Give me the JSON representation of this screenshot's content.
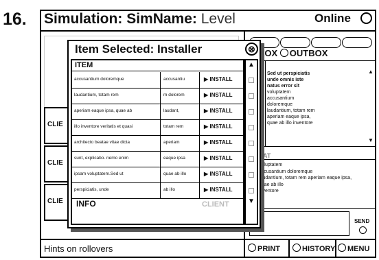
{
  "number_label": "16.",
  "header": {
    "title": "Simulation:",
    "sim_name": "SimName:",
    "level": "Level",
    "status": "Online"
  },
  "clients": [
    "CLIE",
    "CLIE",
    "CLIE"
  ],
  "right_panel": {
    "inbox": "INBOX",
    "outbox": "OUTBOX",
    "msg_left": [
      "ed ut",
      "spic",
      "do",
      "is",
      "atus",
      "ror",
      "apta"
    ],
    "msg_right_bold": [
      "Sed ut perspiciatis",
      "unde omnis iste",
      "natus error sit"
    ],
    "msg_right": [
      "voluptatem",
      "accusantium",
      "doloremque",
      "laudantium, totam rem",
      "aperiam eaque ipsa,",
      "quae ab illo inventore"
    ],
    "chat_label": "CHAT",
    "chat_lines": [
      "voluptatem",
      "accusantium doloremque",
      "laudantium, totam rem aperiam eaque ipsa,",
      "quae ab illo",
      "inventore"
    ],
    "send": "SEND"
  },
  "footer": {
    "hints": "Hints on rollovers",
    "print": "PRINT",
    "history": "HISTORY",
    "menu": "MENU"
  },
  "dialog": {
    "title": "Item Selected: Installer",
    "close_glyph": "⊗",
    "column_header": "ITEM",
    "install_label": "INSTALL",
    "rows": [
      {
        "name": "accusantium doloremque",
        "detail": "accusantiu"
      },
      {
        "name": "laudantium, totam rem",
        "detail": "m dolorem"
      },
      {
        "name": "aperiam eaque ipsa, quae ab",
        "detail": "laudant,"
      },
      {
        "name": "illo inventore veritatis et quasi",
        "detail": "totam rem"
      },
      {
        "name": "architecto beatae vitae dicta",
        "detail": "aperiam"
      },
      {
        "name": "sunt, explicabo. nemo enim",
        "detail": "eaque ipsa"
      },
      {
        "name": "ipsam voluptatem.Sed ut",
        "detail": "quae ab illo"
      },
      {
        "name": "perspiciatis, unde",
        "detail": "ab illo"
      }
    ],
    "info_label": "INFO",
    "ghost_client": "CLIENT"
  },
  "icons": {
    "scroll_up": "▲",
    "scroll_down": "▼",
    "install_arrow": "▶"
  }
}
